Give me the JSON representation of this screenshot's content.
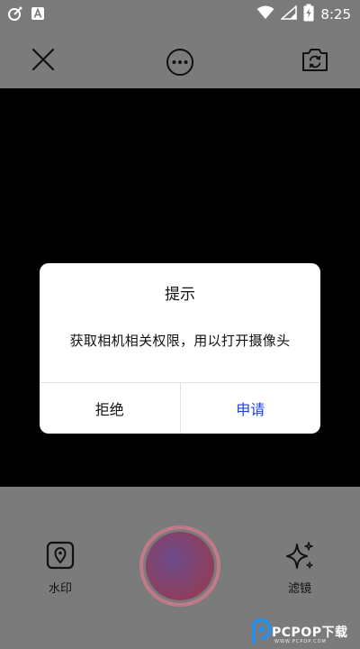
{
  "status_bar": {
    "time": "8:25",
    "left_icons": [
      "satellite-dish-icon",
      "app-a-icon"
    ],
    "right_icons": [
      "wifi-icon",
      "signal-icon",
      "battery-charging-icon"
    ]
  },
  "top_bar": {
    "icons": [
      "close-icon",
      "more-options-icon",
      "switch-camera-icon"
    ]
  },
  "dialog": {
    "title": "提示",
    "message": "获取相机相关权限，用以打开摄像头",
    "reject_label": "拒绝",
    "apply_label": "申请",
    "apply_color": "#1e3fe0"
  },
  "bottom_bar": {
    "watermark_label": "水印",
    "filter_label": "滤镜",
    "shutter_ring_color": "#c4798a"
  },
  "site_watermark": {
    "text": "PCPOP下载",
    "subtext": "WWW.PCPOP.COM"
  }
}
